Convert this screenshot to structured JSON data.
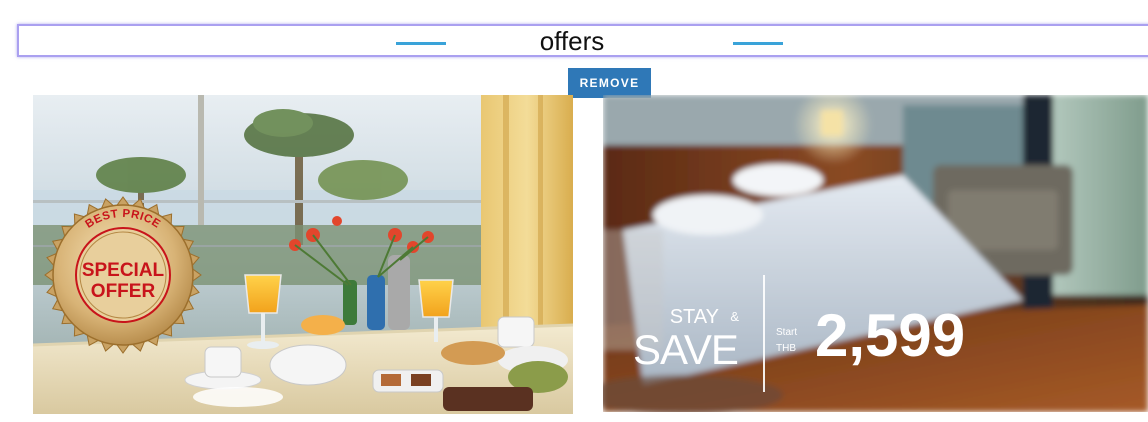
{
  "section": {
    "title": "offers"
  },
  "remove_button": {
    "label": "REMOVE"
  },
  "offers": [
    {
      "badge": {
        "top_text": "BEST PRICE",
        "line1": "SPECIAL",
        "line2": "OFFER"
      }
    },
    {
      "promo": {
        "stay": "STAY",
        "amp": "&",
        "save": "SAVE",
        "start": "Start",
        "currency": "THB",
        "price": "2,599"
      }
    }
  ],
  "colors": {
    "accent_rule": "#3aa3d9",
    "button_bg": "#2f78b7",
    "title_border": "#aaa0f0",
    "badge_red": "#c8141b",
    "badge_gold": "#d9b77a"
  }
}
